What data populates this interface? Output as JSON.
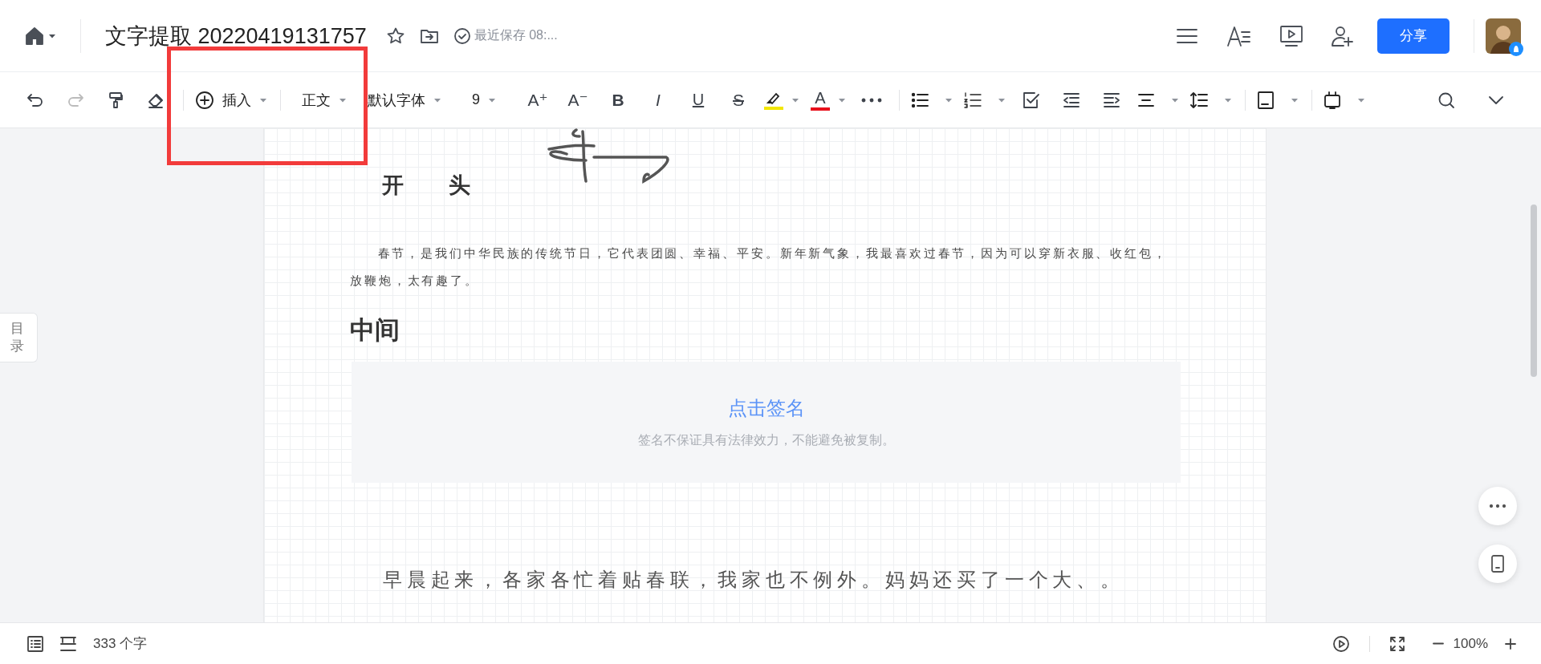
{
  "top_bar": {
    "title": "文字提取 20220419131757",
    "save_status": "最近保存 08:...",
    "share_button": "分享"
  },
  "toolbar": {
    "insert": "插入",
    "paragraph_style": "正文",
    "font": "默认字体",
    "font_size": "9",
    "font_buttons": [
      {
        "kind": "grow",
        "label": "A⁺"
      },
      {
        "kind": "shrink",
        "label": "A⁻"
      },
      {
        "kind": "bold",
        "label": "B"
      },
      {
        "kind": "italic",
        "label": "I"
      },
      {
        "kind": "underline",
        "label": "U"
      },
      {
        "kind": "strike",
        "label": "S"
      }
    ],
    "color_buttons": [
      {
        "kind": "highlight",
        "color": "#f2e600"
      },
      {
        "kind": "font-color",
        "label": "A",
        "color": "#e8101c"
      }
    ]
  },
  "sidebar_tab": "目录",
  "document": {
    "heading_1": "开 头",
    "paragraph_1": "春节，是我们中华民族的传统节日，它代表团圆、幸福、平安。新年新气象，我最喜欢过春节，因为可以穿新衣服、收红包，放鞭炮，太有趣了。",
    "heading_2": "中间",
    "signature": {
      "action": "点击签名",
      "note": "签名不保证具有法律效力，不能避免被复制。"
    },
    "paragraph_2": "早晨起来，各家各忙着贴春联，我家也不例外。妈妈还买了一个大、。"
  },
  "status_bar": {
    "word_count": "333 个字",
    "zoom": "100%"
  },
  "annotation": {
    "kind": "rectangle"
  }
}
